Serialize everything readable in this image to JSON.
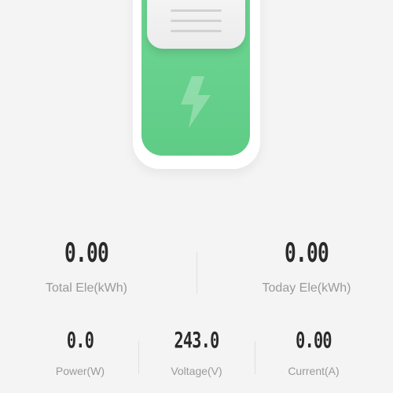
{
  "device": {
    "state": "on",
    "accent_color": "#66d28d",
    "icon": "lightning-bolt-icon"
  },
  "summary": [
    {
      "value": "0.00",
      "label": "Total Ele(kWh)"
    },
    {
      "value": "0.00",
      "label": "Today Ele(kWh)"
    }
  ],
  "metrics": [
    {
      "value": "0.0",
      "label": "Power(W)"
    },
    {
      "value": "243.0",
      "label": "Voltage(V)"
    },
    {
      "value": "0.00",
      "label": "Current(A)"
    }
  ]
}
